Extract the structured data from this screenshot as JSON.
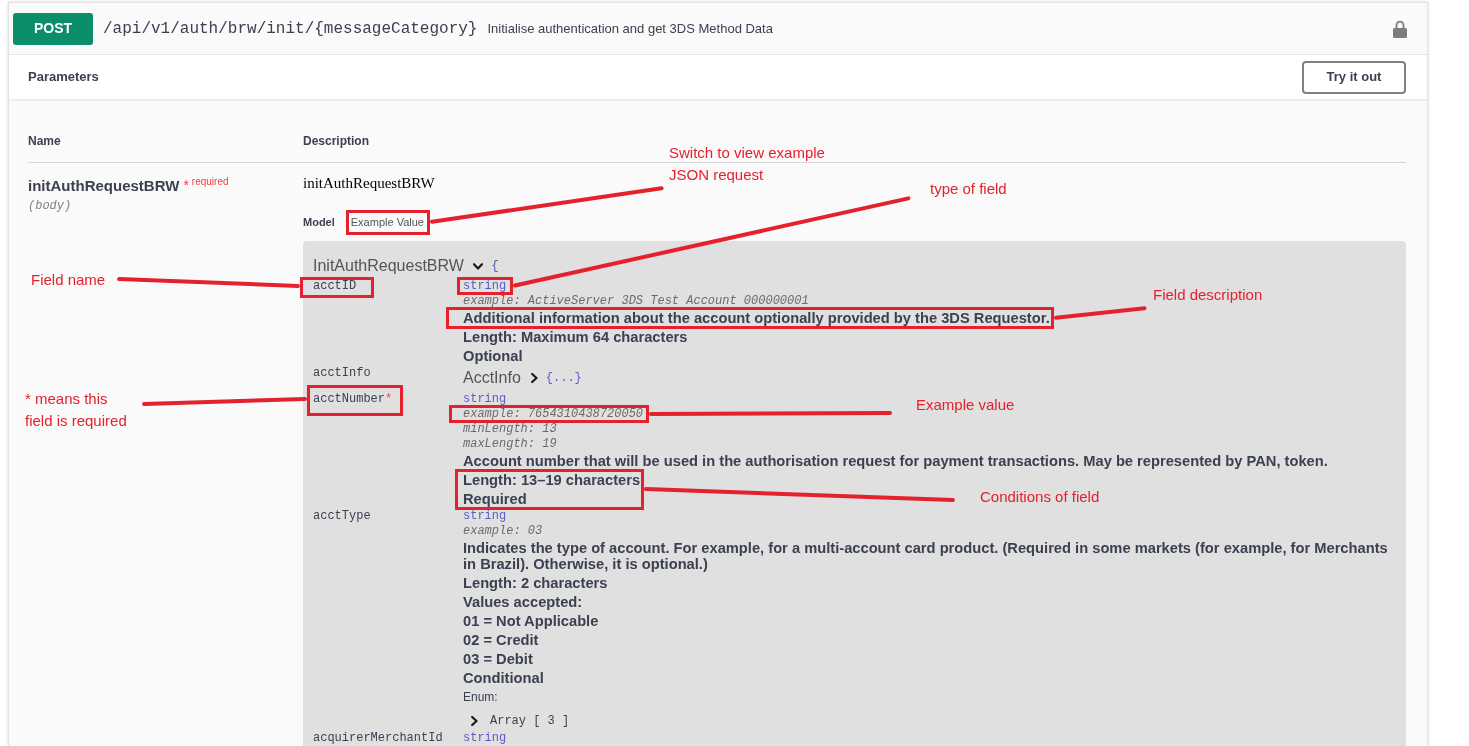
{
  "operation": {
    "method": "POST",
    "path": "/api/v1/auth/brw/init/{messageCategory}",
    "summary": "Initialise authentication and get 3DS Method Data"
  },
  "parameters": {
    "title": "Parameters",
    "try_button": "Try it out",
    "columns": [
      "Name",
      "Description"
    ],
    "rows": [
      {
        "name": "initAuthRequestBRW",
        "required_mark": "*",
        "required_label": "required",
        "location": "(body)",
        "description": "initAuthRequestBRW",
        "model_tabs": [
          {
            "label": "Model",
            "selected": true
          },
          {
            "label": "Example Value",
            "selected": false
          }
        ],
        "model": {
          "title": "InitAuthRequestBRW",
          "expanded": true,
          "brace": "{",
          "properties": [
            {
              "kind": "primitive",
              "name": "acctID",
              "type": "string",
              "details": [
                {
                  "kind": "example",
                  "text": "example: ActiveServer 3DS Test Account 000000001"
                },
                {
                  "kind": "text",
                  "text": "Additional information about the account optionally provided by the 3DS Requestor."
                },
                {
                  "kind": "text",
                  "text": "Length: Maximum 64 characters"
                },
                {
                  "kind": "text",
                  "text": "Optional"
                }
              ]
            },
            {
              "kind": "object",
              "name": "acctInfo",
              "title": "AcctInfo",
              "expanded": false,
              "collapsed": "{...}"
            },
            {
              "kind": "primitive",
              "name": "acctNumber",
              "required_mark": "*",
              "type": "string",
              "details": [
                {
                  "kind": "example",
                  "text": "example: 7654310438720050"
                },
                {
                  "kind": "constraint",
                  "text": "minLength: 13"
                },
                {
                  "kind": "constraint",
                  "text": "maxLength: 19"
                },
                {
                  "kind": "text",
                  "text": "Account number that will be used in the authorisation request for payment transactions. May be represented by PAN, token."
                },
                {
                  "kind": "text",
                  "text": "Length: 13–19 characters"
                },
                {
                  "kind": "text",
                  "text": "Required"
                }
              ]
            },
            {
              "kind": "primitive",
              "name": "acctType",
              "type": "string",
              "details": [
                {
                  "kind": "example",
                  "text": "example: 03"
                },
                {
                  "kind": "text",
                  "text": "Indicates the type of account. For example, for a multi-account card product. (Required in some markets (for example, for Merchants in Brazil). Otherwise, it is optional.)"
                },
                {
                  "kind": "text",
                  "text": "Length: 2 characters"
                },
                {
                  "kind": "text",
                  "text": "Values accepted:"
                },
                {
                  "kind": "text",
                  "text": "01 = Not Applicable"
                },
                {
                  "kind": "text",
                  "text": "02 = Credit"
                },
                {
                  "kind": "text",
                  "text": "03 = Debit"
                },
                {
                  "kind": "text",
                  "text": "Conditional"
                },
                {
                  "kind": "enum",
                  "label": "Enum:",
                  "expanded": false,
                  "summary": "Array [ 3 ]"
                }
              ]
            },
            {
              "kind": "primitive",
              "name": "acquirerMerchantId",
              "type": "string"
            }
          ]
        }
      }
    ]
  },
  "annotations": [
    {
      "lines": [
        "Switch to view example",
        "JSON request"
      ]
    },
    {
      "lines": [
        "type of field"
      ]
    },
    {
      "lines": [
        "Field name"
      ]
    },
    {
      "lines": [
        "Field description"
      ]
    },
    {
      "lines": [
        "* means this",
        "field is required"
      ]
    },
    {
      "lines": [
        "Example value"
      ]
    },
    {
      "lines": [
        "Conditions of field"
      ]
    }
  ]
}
